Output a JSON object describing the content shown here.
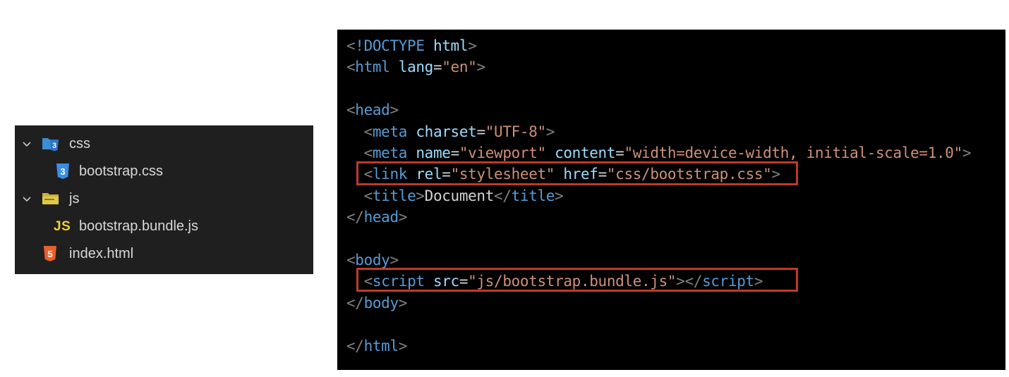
{
  "explorer": {
    "items": [
      {
        "label": "css",
        "type": "folder",
        "expanded": true,
        "icon": "folder-css-icon"
      },
      {
        "label": "bootstrap.css",
        "type": "file",
        "icon": "css3-icon"
      },
      {
        "label": "js",
        "type": "folder",
        "expanded": true,
        "icon": "folder-js-icon"
      },
      {
        "label": "bootstrap.bundle.js",
        "type": "file",
        "icon": "js-icon",
        "icon_text": "JS"
      },
      {
        "label": "index.html",
        "type": "file",
        "icon": "html5-icon"
      }
    ]
  },
  "code": {
    "lines": [
      [
        {
          "c": "p",
          "t": "<"
        },
        {
          "c": "t",
          "t": "!DOCTYPE"
        },
        {
          "c": "x",
          "t": " "
        },
        {
          "c": "a",
          "t": "html"
        },
        {
          "c": "p",
          "t": ">"
        }
      ],
      [
        {
          "c": "p",
          "t": "<"
        },
        {
          "c": "t",
          "t": "html"
        },
        {
          "c": "x",
          "t": " "
        },
        {
          "c": "a",
          "t": "lang"
        },
        {
          "c": "e",
          "t": "="
        },
        {
          "c": "s",
          "t": "\"en\""
        },
        {
          "c": "p",
          "t": ">"
        }
      ],
      [],
      [
        {
          "c": "p",
          "t": "<"
        },
        {
          "c": "t",
          "t": "head"
        },
        {
          "c": "p",
          "t": ">"
        }
      ],
      [
        {
          "c": "x",
          "t": "  "
        },
        {
          "c": "p",
          "t": "<"
        },
        {
          "c": "t",
          "t": "meta"
        },
        {
          "c": "x",
          "t": " "
        },
        {
          "c": "a",
          "t": "charset"
        },
        {
          "c": "e",
          "t": "="
        },
        {
          "c": "s",
          "t": "\"UTF-8\""
        },
        {
          "c": "p",
          "t": ">"
        }
      ],
      [
        {
          "c": "x",
          "t": "  "
        },
        {
          "c": "p",
          "t": "<"
        },
        {
          "c": "t",
          "t": "meta"
        },
        {
          "c": "x",
          "t": " "
        },
        {
          "c": "a",
          "t": "name"
        },
        {
          "c": "e",
          "t": "="
        },
        {
          "c": "s",
          "t": "\"viewport\""
        },
        {
          "c": "x",
          "t": " "
        },
        {
          "c": "a",
          "t": "content"
        },
        {
          "c": "e",
          "t": "="
        },
        {
          "c": "s",
          "t": "\"width=device-width, initial-scale=1.0\""
        },
        {
          "c": "p",
          "t": ">"
        }
      ],
      [
        {
          "c": "x",
          "t": "  "
        },
        {
          "c": "p",
          "t": "<"
        },
        {
          "c": "t",
          "t": "link"
        },
        {
          "c": "x",
          "t": " "
        },
        {
          "c": "a",
          "t": "rel"
        },
        {
          "c": "e",
          "t": "="
        },
        {
          "c": "s",
          "t": "\"stylesheet\""
        },
        {
          "c": "x",
          "t": " "
        },
        {
          "c": "a",
          "t": "href"
        },
        {
          "c": "e",
          "t": "="
        },
        {
          "c": "s",
          "t": "\"css/bootstrap.css\""
        },
        {
          "c": "p",
          "t": ">"
        }
      ],
      [
        {
          "c": "x",
          "t": "  "
        },
        {
          "c": "p",
          "t": "<"
        },
        {
          "c": "t",
          "t": "title"
        },
        {
          "c": "p",
          "t": ">"
        },
        {
          "c": "x",
          "t": "Document"
        },
        {
          "c": "p",
          "t": "</"
        },
        {
          "c": "t",
          "t": "title"
        },
        {
          "c": "p",
          "t": ">"
        }
      ],
      [
        {
          "c": "p",
          "t": "</"
        },
        {
          "c": "t",
          "t": "head"
        },
        {
          "c": "p",
          "t": ">"
        }
      ],
      [],
      [
        {
          "c": "p",
          "t": "<"
        },
        {
          "c": "t",
          "t": "body"
        },
        {
          "c": "p",
          "t": ">"
        }
      ],
      [
        {
          "c": "x",
          "t": "  "
        },
        {
          "c": "p",
          "t": "<"
        },
        {
          "c": "t",
          "t": "script"
        },
        {
          "c": "x",
          "t": " "
        },
        {
          "c": "a",
          "t": "src"
        },
        {
          "c": "e",
          "t": "="
        },
        {
          "c": "s",
          "t": "\"js/bootstrap.bundle.js\""
        },
        {
          "c": "p",
          "t": ">"
        },
        {
          "c": "p",
          "t": "</"
        },
        {
          "c": "t",
          "t": "script"
        },
        {
          "c": "p",
          "t": ">"
        }
      ],
      [
        {
          "c": "p",
          "t": "</"
        },
        {
          "c": "t",
          "t": "body"
        },
        {
          "c": "p",
          "t": ">"
        }
      ],
      [],
      [
        {
          "c": "p",
          "t": "</"
        },
        {
          "c": "t",
          "t": "html"
        },
        {
          "c": "p",
          "t": ">"
        }
      ]
    ],
    "highlighted_lines": [
      6,
      11
    ],
    "highlight_color": "#c0392b"
  },
  "colors": {
    "explorer_bg": "#1f1f1f",
    "code_bg": "#000000",
    "bracket": "#808080",
    "tag": "#569cd6",
    "attribute": "#9cdcfe",
    "string": "#ce9178",
    "text": "#d4d4d4"
  }
}
